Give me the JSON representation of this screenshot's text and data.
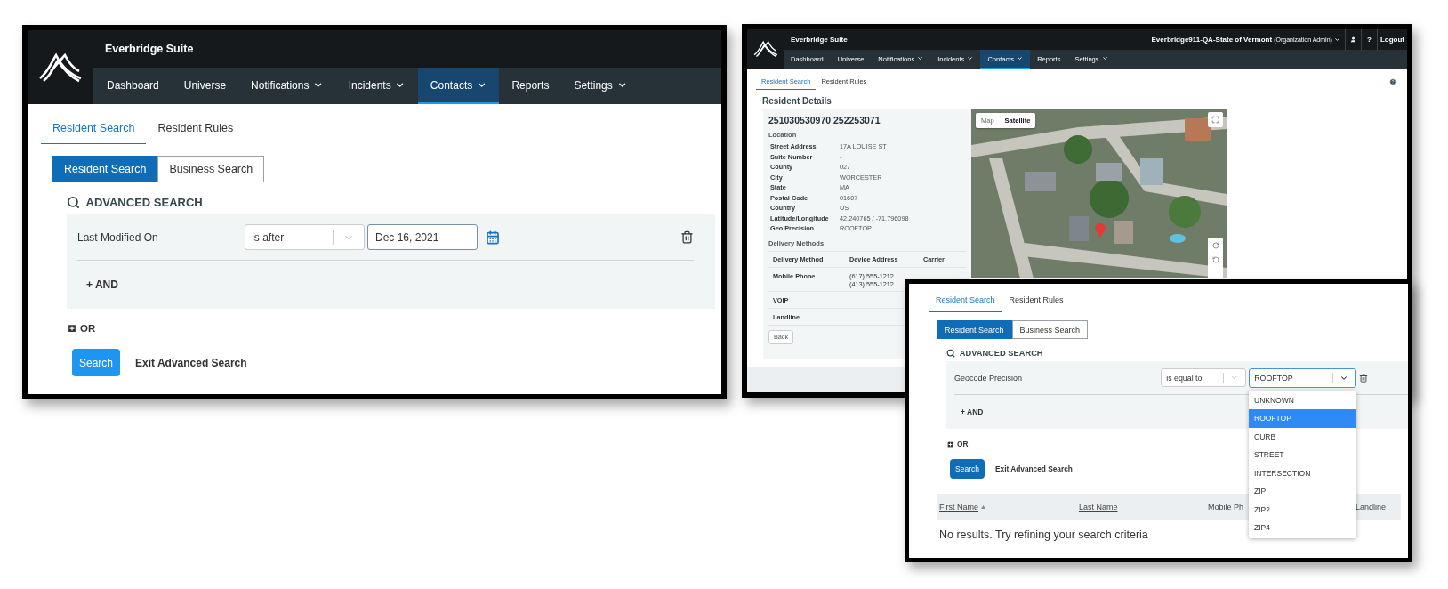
{
  "search_window": {
    "app_title": "Everbridge Suite",
    "nav": [
      {
        "label": "Dashboard",
        "dropdown": false,
        "selected": false
      },
      {
        "label": "Universe",
        "dropdown": false,
        "selected": false
      },
      {
        "label": "Notifications",
        "dropdown": true,
        "selected": false
      },
      {
        "label": "Incidents",
        "dropdown": true,
        "selected": false
      },
      {
        "label": "Contacts",
        "dropdown": true,
        "selected": true
      },
      {
        "label": "Reports",
        "dropdown": false,
        "selected": false
      },
      {
        "label": "Settings",
        "dropdown": true,
        "selected": false
      }
    ],
    "tabs": [
      {
        "label": "Resident Search",
        "selected": true
      },
      {
        "label": "Resident Rules",
        "selected": false
      }
    ],
    "search_types": [
      {
        "label": "Resident Search",
        "selected": true
      },
      {
        "label": "Business Search",
        "selected": false
      }
    ],
    "advanced_title": "ADVANCED SEARCH",
    "condition": {
      "field": "Last Modified On",
      "operator": "is after",
      "value": "Dec 16, 2021"
    },
    "and_label": "+ AND",
    "or_label": "OR",
    "search_button": "Search",
    "exit_link": "Exit Advanced Search"
  },
  "details_window": {
    "app_title": "Everbridge Suite",
    "account": "Everbridge911-QA-State of Vermont",
    "role": "(Organization Admin)",
    "help_label": "?",
    "logout": "Logout",
    "nav": [
      {
        "label": "Dashboard",
        "dropdown": false,
        "selected": false
      },
      {
        "label": "Universe",
        "dropdown": false,
        "selected": false
      },
      {
        "label": "Notifications",
        "dropdown": true,
        "selected": false
      },
      {
        "label": "Incidents",
        "dropdown": true,
        "selected": false
      },
      {
        "label": "Contacts",
        "dropdown": true,
        "selected": true
      },
      {
        "label": "Reports",
        "dropdown": false,
        "selected": false
      },
      {
        "label": "Settings",
        "dropdown": true,
        "selected": false
      }
    ],
    "tabs": [
      {
        "label": "Resident Search",
        "selected": true
      },
      {
        "label": "Resident Rules",
        "selected": false
      }
    ],
    "heading": "Resident Details",
    "resident_id": "251030530970 252253071",
    "location_heading": "Location",
    "location_fields": [
      {
        "label": "Street Address",
        "value": "17A LOUISE ST"
      },
      {
        "label": "Suite Number",
        "value": "-"
      },
      {
        "label": "County",
        "value": "027"
      },
      {
        "label": "City",
        "value": "WORCESTER"
      },
      {
        "label": "State",
        "value": "MA"
      },
      {
        "label": "Postal Code",
        "value": "01607"
      },
      {
        "label": "Country",
        "value": "US"
      },
      {
        "label": "Latitude/Longitude",
        "value": "42.240765 / -71.796098"
      },
      {
        "label": "Geo Precision",
        "value": "ROOFTOP"
      }
    ],
    "delivery_heading": "Delivery Methods",
    "delivery_columns": [
      "Delivery Method",
      "Device Address",
      "Carrier"
    ],
    "delivery_rows": [
      {
        "method": "Mobile Phone",
        "addresses": [
          "(617) 555-1212",
          "(413) 555-1212"
        ]
      },
      {
        "method": "VOIP"
      },
      {
        "method": "Landline"
      }
    ],
    "back_button": "Back",
    "map": {
      "kind": "picture",
      "views": [
        {
          "label": "Map",
          "selected": false
        },
        {
          "label": "Satellite",
          "selected": true
        }
      ]
    }
  },
  "results_window": {
    "tabs": [
      {
        "label": "Resident Search",
        "selected": true
      },
      {
        "label": "Resident Rules",
        "selected": false
      }
    ],
    "search_types": [
      {
        "label": "Resident Search",
        "selected": true
      },
      {
        "label": "Business Search",
        "selected": false
      }
    ],
    "advanced_title": "ADVANCED SEARCH",
    "condition": {
      "field": "Geocode Precision",
      "operator": "is equal to",
      "value": "ROOFTOP"
    },
    "options": [
      {
        "label": "UNKNOWN",
        "selected": false
      },
      {
        "label": "ROOFTOP",
        "selected": true
      },
      {
        "label": "CURB",
        "selected": false
      },
      {
        "label": "STREET",
        "selected": false
      },
      {
        "label": "INTERSECTION",
        "selected": false
      },
      {
        "label": "ZIP",
        "selected": false
      },
      {
        "label": "ZIP2",
        "selected": false
      },
      {
        "label": "ZIP4",
        "selected": false
      }
    ],
    "and_label": "+ AND",
    "or_label": "OR",
    "search_button": "Search",
    "exit_link": "Exit Advanced Search",
    "columns": [
      {
        "label": "First Name",
        "sortable": true,
        "sorted": true
      },
      {
        "label": "Last Name",
        "sortable": true,
        "sorted": false
      },
      {
        "label": "Mobile Ph",
        "sortable": false,
        "sorted": false
      },
      {
        "label": "Landline",
        "sortable": false,
        "sorted": false
      }
    ],
    "empty_message": "No results. Try refining your search criteria"
  }
}
